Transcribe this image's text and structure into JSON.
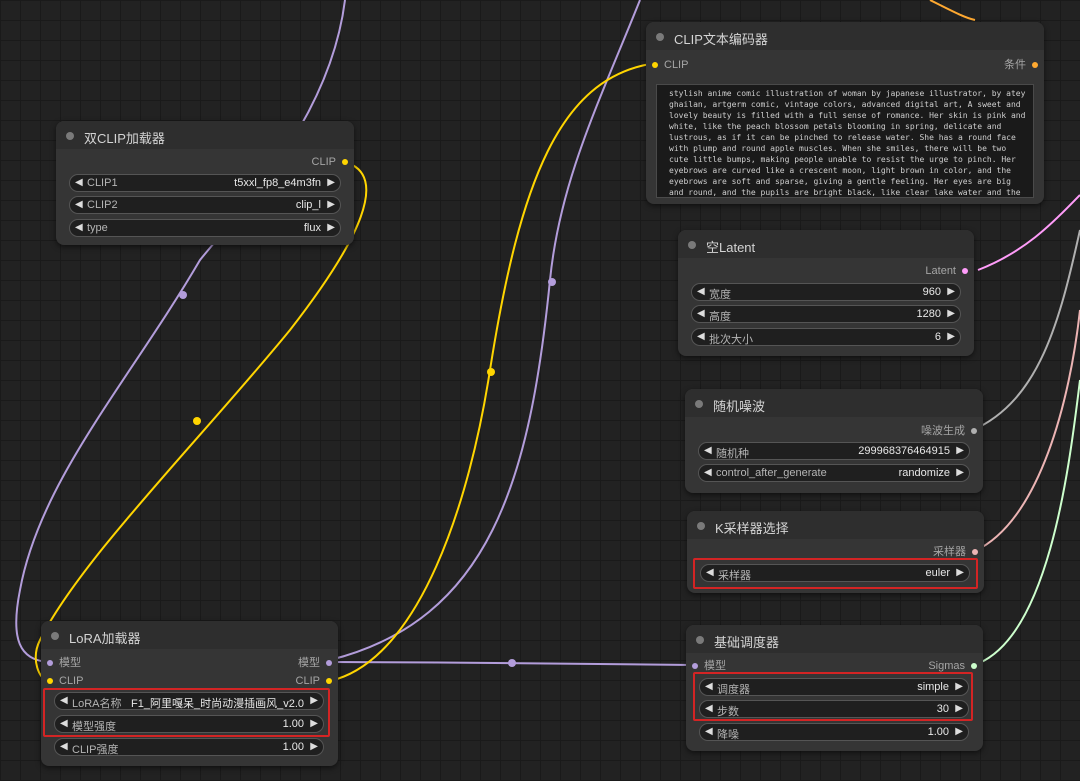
{
  "colors": {
    "model": "#b39ddb",
    "clip": "#ffd500",
    "conditioning": "#ffa931",
    "latent": "#ff9cf9",
    "noise": "#b0b0b0",
    "sampler": "#ecb4b4",
    "sigmas": "#cdffcd",
    "highlight": "#d32424"
  },
  "nodes": {
    "clip_text_encode": {
      "title": "CLIP文本编码器",
      "input_clip": "CLIP",
      "output_conditioning": "条件",
      "text": "stylish anime comic illustration of woman by japanese illustrator, by atey ghailan, artgerm comic, vintage colors, advanced digital art, A sweet and lovely beauty is filled with a full sense of romance. Her skin is pink and white, like the peach blossom petals blooming in spring, delicate and lustrous, as if it can be pinched to release water. She has a round face with plump and round apple muscles. When she smiles, there will be two cute little bumps, making people unable to resist the urge to pinch. Her eyebrows are curved like a crescent moon, light brown in color, and the eyebrows are soft and sparse, giving a gentle feeling. Her eyes are big and round, and the pupils are bright black, like clear lake water and the stars twinkling in the"
    },
    "dual_clip_loader": {
      "title": "双CLIP加载器",
      "output_clip": "CLIP",
      "widgets": [
        {
          "label": "CLIP1",
          "value": "t5xxl_fp8_e4m3fn"
        },
        {
          "label": "CLIP2",
          "value": "clip_l"
        },
        {
          "label": "type",
          "value": "flux"
        }
      ]
    },
    "empty_latent": {
      "title": "空Latent",
      "output_latent": "Latent",
      "widgets": [
        {
          "label": "宽度",
          "value": "960"
        },
        {
          "label": "高度",
          "value": "1280"
        },
        {
          "label": "批次大小",
          "value": "6"
        }
      ]
    },
    "random_noise": {
      "title": "随机噪波",
      "output_noise": "噪波生成",
      "widgets": [
        {
          "label": "随机种",
          "value": "299968376464915"
        },
        {
          "label": "control_after_generate",
          "value": "randomize"
        }
      ]
    },
    "k_sampler_select": {
      "title": "K采样器选择",
      "output_sampler": "采样器",
      "widgets": [
        {
          "label": "采样器",
          "value": "euler"
        }
      ]
    },
    "basic_scheduler": {
      "title": "基础调度器",
      "input_model": "模型",
      "output_sigmas": "Sigmas",
      "widgets": [
        {
          "label": "调度器",
          "value": "simple"
        },
        {
          "label": "步数",
          "value": "30"
        },
        {
          "label": "降噪",
          "value": "1.00"
        }
      ]
    },
    "lora_loader": {
      "title": "LoRA加载器",
      "input_model": "模型",
      "input_clip": "CLIP",
      "output_model": "模型",
      "output_clip": "CLIP",
      "widgets": [
        {
          "label": "LoRA名称",
          "value": "F1_阿里嘎呆_时尚动漫插画风_v2.0"
        },
        {
          "label": "模型强度",
          "value": "1.00"
        },
        {
          "label": "CLIP强度",
          "value": "1.00"
        }
      ]
    }
  },
  "icons": {
    "arrow_left": "◀",
    "arrow_right": "▶"
  }
}
